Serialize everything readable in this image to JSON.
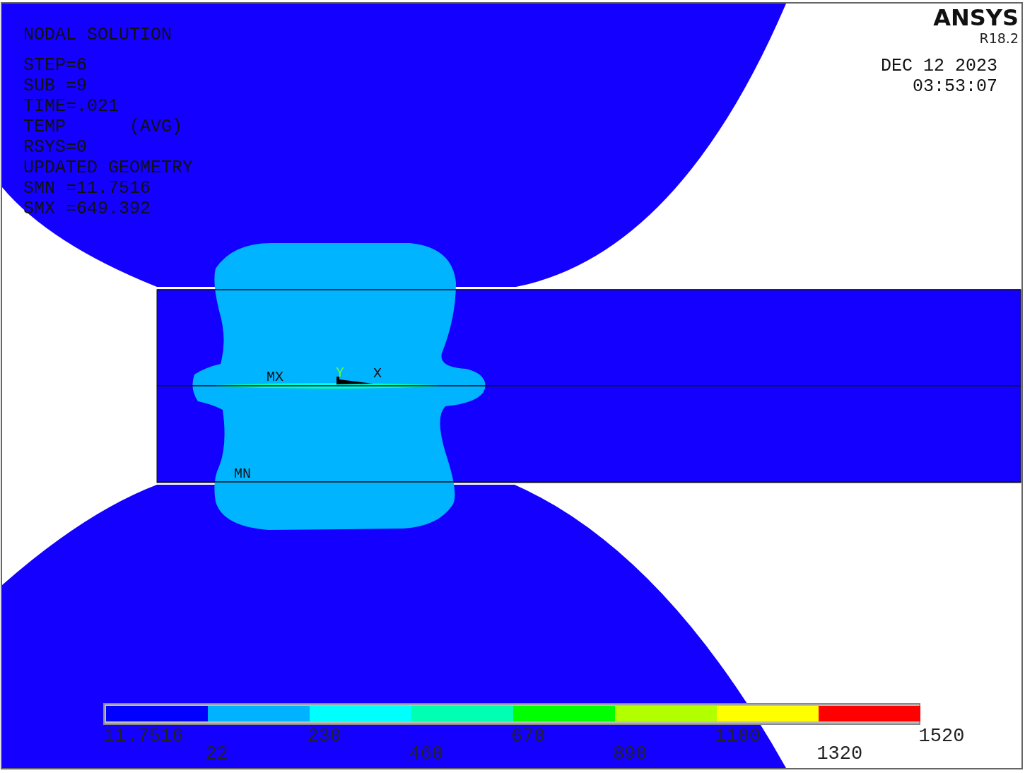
{
  "plot": {
    "info_lines": [
      "NODAL SOLUTION",
      "STEP=6",
      "SUB =9",
      "TIME=.021",
      "TEMP      (AVG)",
      "RSYS=0",
      "UPDATED GEOMETRY",
      "SMN =11.7516",
      "SMX =649.392"
    ],
    "logo": "ANSYS",
    "version": "R18.2",
    "date": "DEC 12 2023",
    "time": "03:53:07",
    "max_marker": "MX",
    "min_marker": "MN",
    "axis_y": "Y",
    "axis_x": "X"
  },
  "legend": {
    "segments": [
      {
        "color": "#0000ff"
      },
      {
        "color": "#00b2ff"
      },
      {
        "color": "#00ffff"
      },
      {
        "color": "#00ffb2"
      },
      {
        "color": "#00ff00"
      },
      {
        "color": "#b2ff00"
      },
      {
        "color": "#ffff00"
      },
      {
        "color": "#ff0000"
      }
    ],
    "labels": [
      "11.7516",
      "22",
      "230",
      "460",
      "670",
      "890",
      "1100",
      "1320",
      "1520"
    ]
  }
}
